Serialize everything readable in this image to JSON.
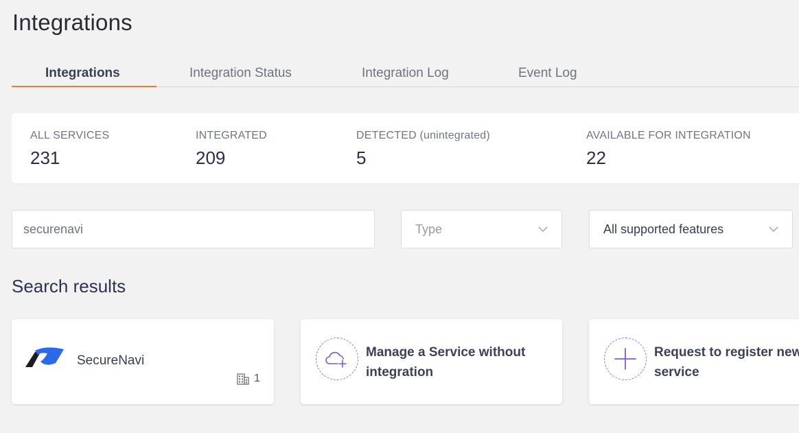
{
  "header": {
    "title": "Integrations"
  },
  "tabs": [
    {
      "label": "Integrations",
      "active": true
    },
    {
      "label": "Integration Status",
      "active": false
    },
    {
      "label": "Integration Log",
      "active": false
    },
    {
      "label": "Event Log",
      "active": false
    }
  ],
  "stats": [
    {
      "label": "ALL SERVICES",
      "value": "231"
    },
    {
      "label": "INTEGRATED",
      "value": "209"
    },
    {
      "label": "DETECTED (unintegrated)",
      "value": "5"
    },
    {
      "label": "AVAILABLE FOR INTEGRATION",
      "value": "22"
    }
  ],
  "filters": {
    "search_value": "securenavi",
    "type_placeholder": "Type",
    "features_value": "All supported features"
  },
  "results": {
    "title": "Search results",
    "service": {
      "name": "SecureNavi",
      "count": "1"
    },
    "manage_card": {
      "line1": "Manage a Service without",
      "line2": "integration"
    },
    "request_card": {
      "line1": "Request to register new",
      "line2": "service"
    }
  },
  "colors": {
    "accent": "#ef7a3f",
    "purple": "#7b5cd6",
    "logo_blue": "#2a6ae8"
  },
  "icons": [
    "cloud-add-icon",
    "plus-icon",
    "building-icon",
    "chevron-down-icon",
    "securenavi-logo"
  ]
}
